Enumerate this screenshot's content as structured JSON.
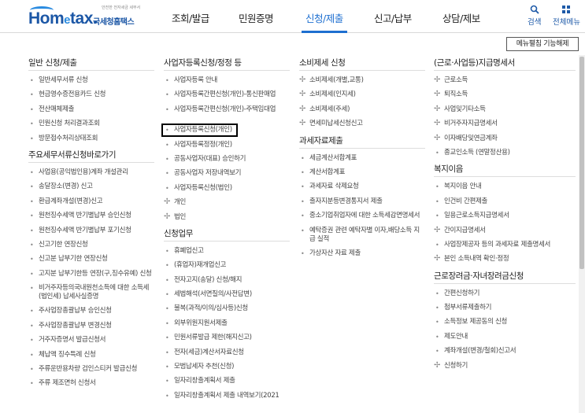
{
  "header": {
    "logo_tagline": "안전한 전자세금 세무서",
    "logo_word_pre": "Hom",
    "logo_word_e": "e",
    "logo_word_post": "tax.",
    "logo_kr": "국세청홈택스",
    "nav": [
      {
        "label": "조회/발급",
        "active": false
      },
      {
        "label": "민원증명",
        "active": false
      },
      {
        "label": "신청/제출",
        "active": true
      },
      {
        "label": "신고/납부",
        "active": false
      },
      {
        "label": "상담/제보",
        "active": false
      }
    ],
    "search_label": "검색",
    "allmenu_label": "전체메뉴",
    "accent_color": "#1e6fd0"
  },
  "edit_button_label": "메뉴펼침 기능해제",
  "columns": [
    {
      "sections": [
        {
          "title": "일반 신청/제출",
          "items": [
            {
              "label": "일반세무서류 신청"
            },
            {
              "label": "현금영수증전용카드 신청"
            },
            {
              "label": "전산매체제출"
            },
            {
              "label": "민원신청 처리결과조회"
            },
            {
              "label": "방문접수처리상태조회"
            }
          ]
        },
        {
          "title": "주요세무서류신청바로가기",
          "items": [
            {
              "label": "사업용(공익법인용)계좌 개설관리"
            },
            {
              "label": "송달장소(변경) 신고"
            },
            {
              "label": "환급계좌개설(변경)신고"
            },
            {
              "label": "원천징수세액 반기별납부 승인신청"
            },
            {
              "label": "원천징수세액 반기별납부 포기신청"
            },
            {
              "label": "신고기한 연장신청"
            },
            {
              "label": "신고분 납부기한 연장신청"
            },
            {
              "label": "고지분 납부기한등 연장(구,징수유예) 신청"
            },
            {
              "label": "비거주자등의국내원천소득에 대한 소득세(법인세) 납세사실증명"
            },
            {
              "label": "주사업장총괄납부 승인신청"
            },
            {
              "label": "주사업장총괄납부 변경신청"
            },
            {
              "label": "거주자증명서 발급신청서"
            },
            {
              "label": "체납액 징수특례 신청"
            },
            {
              "label": "주류운반용차량 검인스티커 발급신청"
            },
            {
              "label": "주류 제조면허 신청서"
            }
          ]
        }
      ]
    },
    {
      "sections": [
        {
          "title": "사업자등록신청/정정 등",
          "items": [
            {
              "label": "사업자등록 안내",
              "plus": false
            },
            {
              "label": "사업자등록간편신청(개인)-통신판매업",
              "plus": false
            },
            {
              "label": "사업자등록간편신청(개인)-주택임대업",
              "plus": false
            },
            {
              "label": "사업자등록신청(개인)",
              "plus": false,
              "highlight": true
            },
            {
              "label": "사업자등록정정(개인)",
              "plus": false
            },
            {
              "label": "공동사업자(대표) 승인하기",
              "plus": false
            },
            {
              "label": "공동사업자 저장내역보기",
              "plus": false
            },
            {
              "label": "사업자등록신청(법인)",
              "plus": false
            },
            {
              "label": "개인",
              "plus": true
            },
            {
              "label": "법인",
              "plus": true
            }
          ]
        },
        {
          "title": "신청업무",
          "items": [
            {
              "label": "휴폐업신고"
            },
            {
              "label": "(휴업자)재개업신고"
            },
            {
              "label": "전자고지(송달) 신청/해지"
            },
            {
              "label": "세법해석(서면질의/사전답변)"
            },
            {
              "label": "불복(과적/이의/심사등)신청"
            },
            {
              "label": "외부위원지원서제출"
            },
            {
              "label": "민원서류발급 제한(해지신고)"
            },
            {
              "label": "전자(세금)계산서자료신청"
            },
            {
              "label": "모범납세자 추천(신청)"
            },
            {
              "label": "일자리창출계획서 제출"
            },
            {
              "label": "일자리창출계획서 제출 내역보기(2021"
            }
          ]
        }
      ]
    },
    {
      "sections": [
        {
          "title": "소비제세 신청",
          "items": [
            {
              "label": "소비제세(개별,교통)",
              "plus": true
            },
            {
              "label": "소비제세(인지세)",
              "plus": true
            },
            {
              "label": "소비제세(주세)",
              "plus": true
            },
            {
              "label": "면세미납세신청신고",
              "plus": true
            }
          ]
        },
        {
          "title": "과세자료제출",
          "items": [
            {
              "label": "세금계산서합계표"
            },
            {
              "label": "계산서합계표"
            },
            {
              "label": "과세자료 삭제요청"
            },
            {
              "label": "출자지분등변경통지서 제출"
            },
            {
              "label": "중소기업취업자에 대한 소득세감면명세서"
            },
            {
              "label": "예탁증권 관련 예탁자별 이자,배당소득 지급 실적"
            },
            {
              "label": "가상자산 자료 제출"
            }
          ]
        }
      ]
    },
    {
      "sections": [
        {
          "title": "(근로·사업등)지급명세서",
          "items": [
            {
              "label": "근로소득",
              "plus": true
            },
            {
              "label": "퇴직소득",
              "plus": true
            },
            {
              "label": "사업및기타소득",
              "plus": true
            },
            {
              "label": "비거주자지급명세서",
              "plus": true
            },
            {
              "label": "이자배당및연금계좌",
              "plus": true
            },
            {
              "label": "종교인소득 (연말정산용)",
              "plus": false
            }
          ]
        },
        {
          "title": "복지이음",
          "items": [
            {
              "label": "복지이음 안내",
              "plus": false
            },
            {
              "label": "인건비 간편제출",
              "plus": false
            },
            {
              "label": "일용근로소득지급명세서",
              "plus": false
            },
            {
              "label": "간이지급명세서",
              "plus": true
            },
            {
              "label": "사업장제공자 등의 과세자료 제출명세서",
              "plus": false
            },
            {
              "label": "본인 소득내역 확인·정정",
              "plus": true
            }
          ]
        },
        {
          "title": "근로장려금·자녀장려금신청",
          "items": [
            {
              "label": "간편신청하기",
              "plus": false
            },
            {
              "label": "첨부서류제출하기",
              "plus": false
            },
            {
              "label": "소득정보 제공동의 신청",
              "plus": false
            },
            {
              "label": "제도안내",
              "plus": false
            },
            {
              "label": "계좌개설(변경/철회)신고서",
              "plus": false
            },
            {
              "label": "신청하기",
              "plus": true
            }
          ]
        }
      ]
    }
  ]
}
